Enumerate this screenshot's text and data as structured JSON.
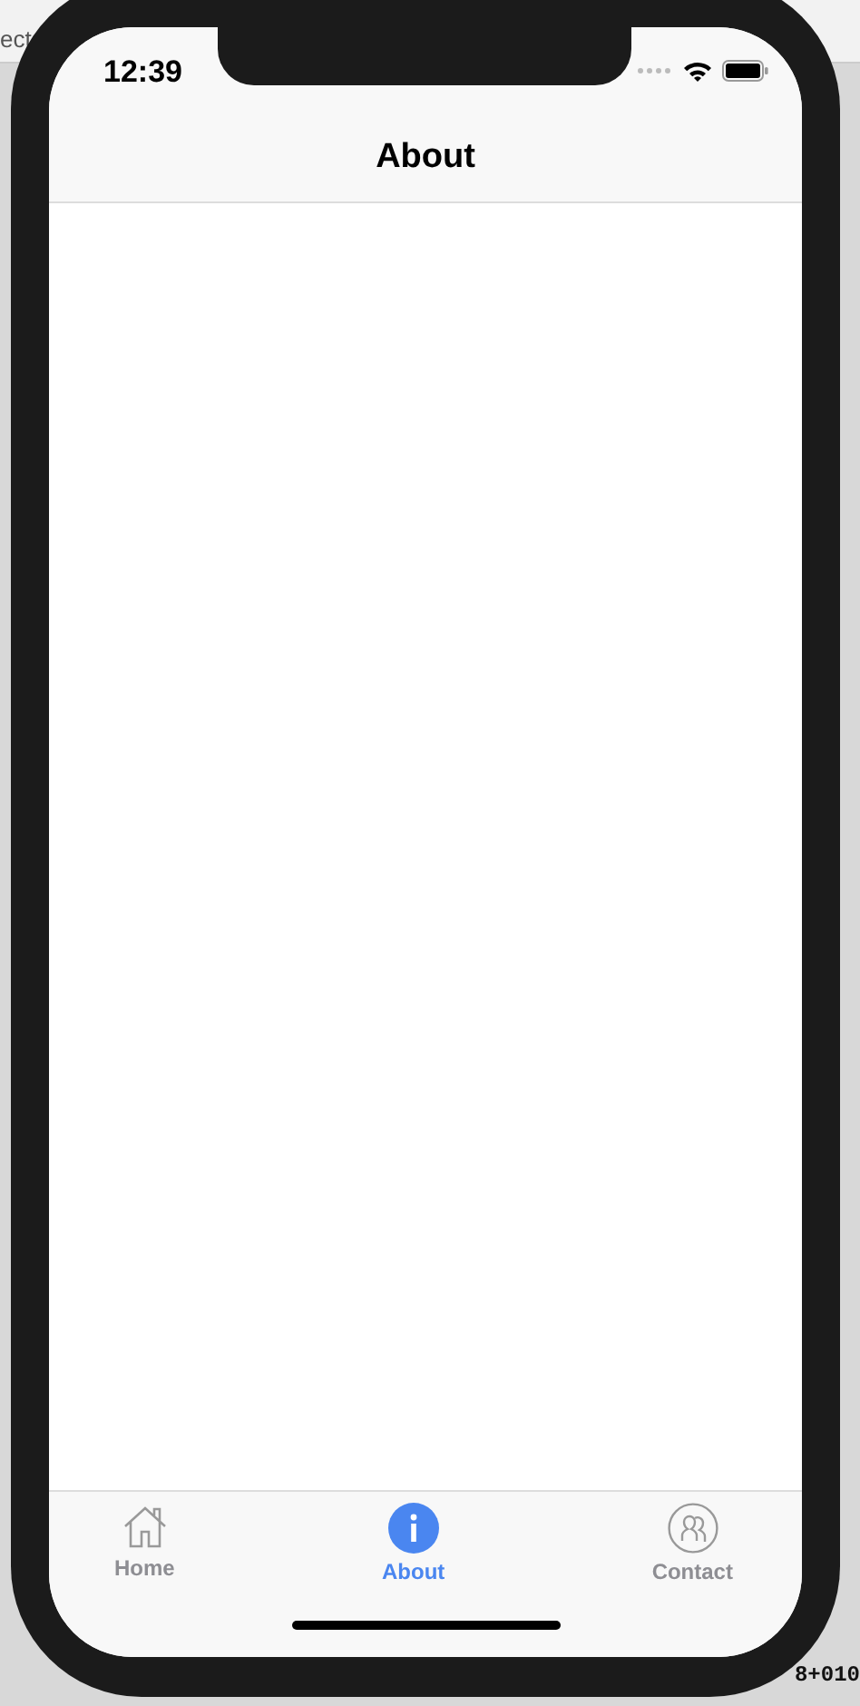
{
  "backdrop": {
    "top_text": "ect",
    "bottom_text": "8+010"
  },
  "status_bar": {
    "time": "12:39"
  },
  "nav": {
    "title": "About"
  },
  "tabs": [
    {
      "label": "Home",
      "kind": "home",
      "selected": false
    },
    {
      "label": "About",
      "kind": "info",
      "selected": true
    },
    {
      "label": "Contact",
      "kind": "contact",
      "selected": false
    }
  ]
}
